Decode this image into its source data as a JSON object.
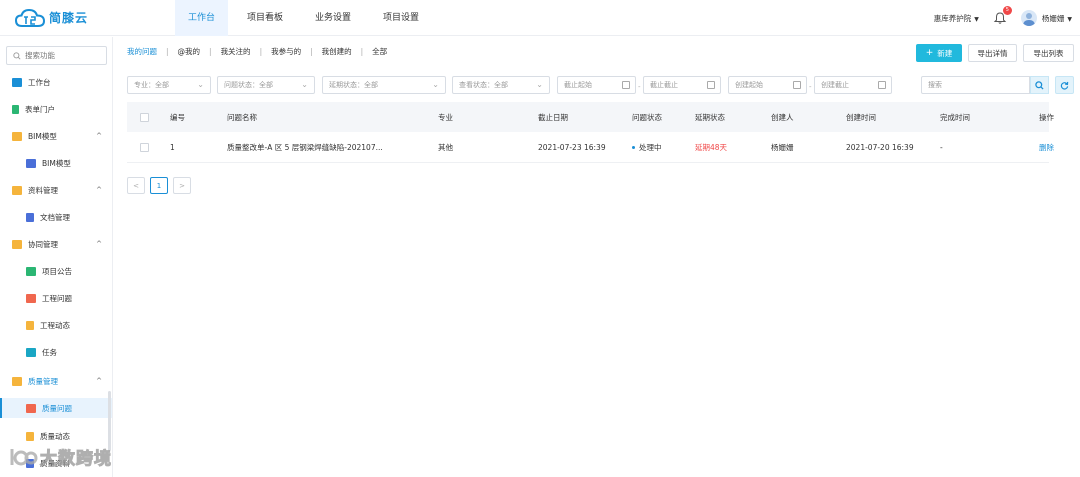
{
  "header": {
    "brand": "简膝云",
    "nav": [
      {
        "label": "工作台",
        "active": true
      },
      {
        "label": "项目看板",
        "active": false
      },
      {
        "label": "业务设置",
        "active": false
      },
      {
        "label": "项目设置",
        "active": false
      }
    ],
    "org": "惠库养护院",
    "notification_count": "5",
    "user": "杨姗姗",
    "accent_color": "#1a8fd6"
  },
  "sidebar": {
    "search_placeholder": "搜索功能",
    "items": [
      {
        "label": "工作台",
        "level": 1,
        "icon": "dashboard-icon"
      },
      {
        "label": "表单门户",
        "level": 1,
        "icon": "form-icon"
      },
      {
        "label": "BIM模型",
        "level": 1,
        "icon": "folder-icon",
        "expanded": true
      },
      {
        "label": "BIM模型",
        "level": 2,
        "icon": "building-icon"
      },
      {
        "label": "资料管理",
        "level": 1,
        "icon": "folder-icon",
        "expanded": true
      },
      {
        "label": "文档管理",
        "level": 2,
        "icon": "document-icon"
      },
      {
        "label": "协同管理",
        "level": 1,
        "icon": "folder-icon",
        "expanded": true
      },
      {
        "label": "项目公告",
        "level": 2,
        "icon": "announcement-icon"
      },
      {
        "label": "工程问题",
        "level": 2,
        "icon": "issue-icon"
      },
      {
        "label": "工程动态",
        "level": 2,
        "icon": "activity-icon"
      },
      {
        "label": "任务",
        "level": 2,
        "icon": "task-icon"
      },
      {
        "label": "质量管理",
        "level": 1,
        "icon": "folder-icon",
        "expanded": true
      },
      {
        "label": "质量问题",
        "level": 2,
        "icon": "issue-icon",
        "active": true
      },
      {
        "label": "质量动态",
        "level": 2,
        "icon": "activity-icon"
      },
      {
        "label": "质量资料",
        "level": 2,
        "icon": "document-icon"
      }
    ]
  },
  "filter_tabs": [
    {
      "label": "我的问题",
      "active": true
    },
    {
      "label": "@我的"
    },
    {
      "label": "我关注的"
    },
    {
      "label": "我参与的"
    },
    {
      "label": "我创建的"
    },
    {
      "label": "全部"
    }
  ],
  "actions": {
    "new_label": "新建",
    "export_detail_label": "导出详情",
    "export_list_label": "导出列表"
  },
  "filters": {
    "major": "专业：全部",
    "issue_status": "问题状态：全部",
    "delay_status": "延期状态：全部",
    "view_status": "查看状态：全部",
    "deadline_start": "截止起始",
    "deadline_end": "截止截止",
    "created_start": "创建起始",
    "created_end": "创建截止",
    "search_placeholder": "搜索"
  },
  "table": {
    "columns": [
      "编号",
      "问题名称",
      "专业",
      "截止日期",
      "问题状态",
      "延期状态",
      "创建人",
      "创建时间",
      "完成时间",
      "操作"
    ],
    "rows": [
      {
        "no": "1",
        "name": "质量整改单-A 区 5 层钢梁焊缝缺陷-202107...",
        "major": "其他",
        "deadline": "2021-07-23 16:39",
        "status": "处理中",
        "delay": "延期48天",
        "creator": "杨姗姗",
        "created": "2021-07-20 16:39",
        "completed": "-",
        "action": "删除"
      }
    ]
  },
  "pagination": {
    "current": "1",
    "prev": "<",
    "next": ">"
  },
  "watermark": {
    "text": "大数跨境"
  }
}
